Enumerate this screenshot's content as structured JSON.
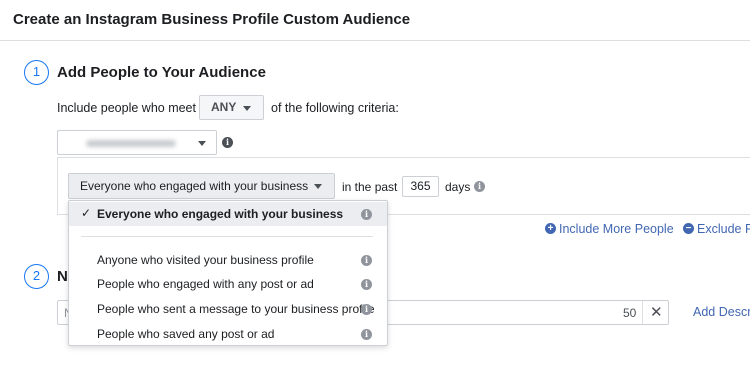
{
  "header": {
    "title": "Create an Instagram Business Profile Custom Audience"
  },
  "step1": {
    "number": "1",
    "title": "Add People to Your Audience"
  },
  "criteria": {
    "prefix": "Include people who meet",
    "match_value": "ANY",
    "suffix": "of the following criteria:"
  },
  "rule": {
    "engagement_value": "Everyone who engaged with your business",
    "in_the_past_label": "in the past",
    "days_value": "365",
    "days_label": "days"
  },
  "dropdown": {
    "selected": "Everyone who engaged with your business",
    "options": [
      "Anyone who visited your business profile",
      "People who engaged with any post or ad",
      "People who sent a message to your business profile",
      "People who saved any post or ad"
    ]
  },
  "actions": {
    "include_more": "Include More People",
    "exclude": "Exclude P"
  },
  "step2": {
    "number": "2",
    "title_partial": "N",
    "input_placeholder_partial": "N",
    "char_count": "50",
    "add_description": "Add Descr"
  },
  "colors": {
    "accent": "#1877f2",
    "link": "#4267b2",
    "border": "#ccd0d5",
    "selected_bg": "#ebedf0"
  },
  "icons": {
    "info": "info-icon",
    "check": "check-icon",
    "caret": "caret-down-icon",
    "plus": "plus-circle-icon",
    "minus": "minus-circle-icon",
    "clear": "close-icon"
  }
}
